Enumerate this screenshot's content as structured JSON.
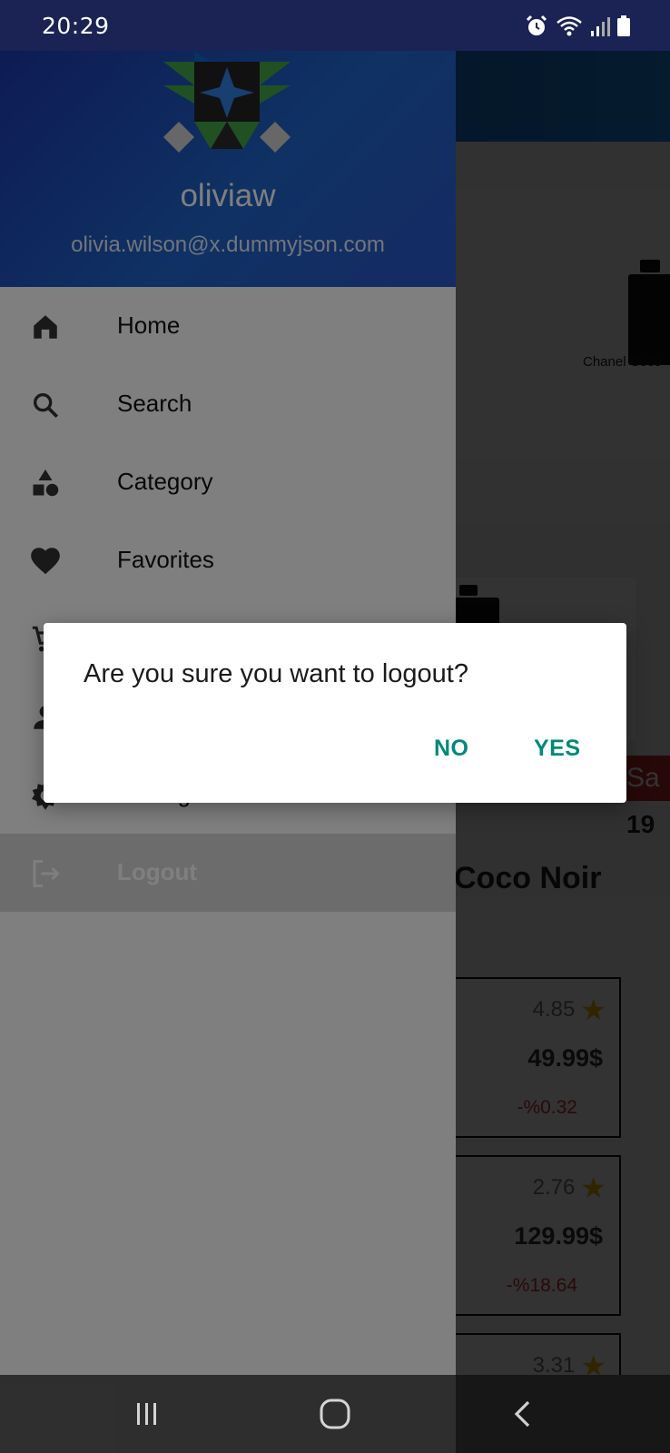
{
  "status_bar": {
    "time": "20:29"
  },
  "background": {
    "featured_caption": "Chanel Coco",
    "sale_badge": "Sa",
    "product_price_partial": "19",
    "product_name_partial": "Coco Noir",
    "products": [
      {
        "rating": "4.85",
        "price": "49.99$",
        "discount": "-%0.32"
      },
      {
        "rating": "2.76",
        "price": "129.99$",
        "discount": "-%18.64"
      },
      {
        "rating": "3.31"
      }
    ]
  },
  "drawer": {
    "username": "oliviaw",
    "email": "olivia.wilson@x.dummyjson.com",
    "menu": [
      {
        "label": "Home",
        "icon": "home-icon"
      },
      {
        "label": "Search",
        "icon": "search-icon"
      },
      {
        "label": "Category",
        "icon": "category-icon"
      },
      {
        "label": "Favorites",
        "icon": "heart-icon"
      },
      {
        "label": "",
        "icon": "cart-icon"
      },
      {
        "label": "",
        "icon": "person-icon"
      },
      {
        "label": "Settings",
        "icon": "gear-icon"
      },
      {
        "label": "Logout",
        "icon": "logout-icon",
        "selected": true
      }
    ]
  },
  "dialog": {
    "message": "Are you sure you want to logout?",
    "no_label": "NO",
    "yes_label": "YES"
  },
  "colors": {
    "status_bar": "#1a2353",
    "header_gradient_start": "#1c36a8",
    "header_gradient_end": "#2a57c8",
    "dialog_button": "#00897b",
    "discount": "#d32f2f",
    "star": "#f5b400"
  }
}
